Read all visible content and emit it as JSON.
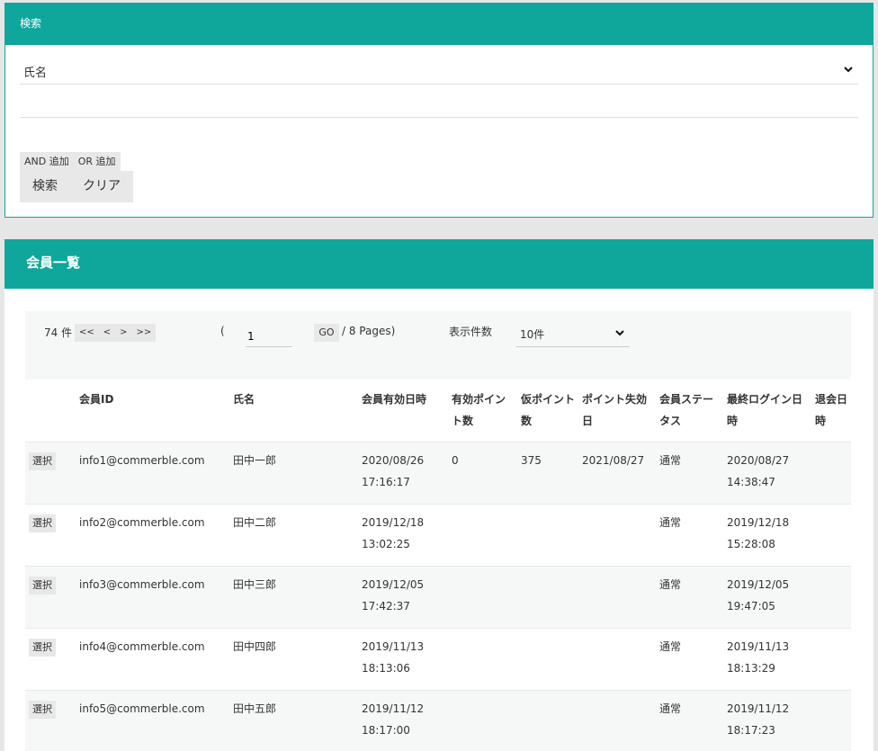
{
  "search": {
    "title": "検索",
    "field": "氏名",
    "input_value": "",
    "and_label": "AND 追加",
    "or_label": "OR 追加",
    "search_label": "検索",
    "clear_label": "クリア"
  },
  "list": {
    "title": "会員一覧",
    "pager": {
      "count": "74 件",
      "first": "<<",
      "prev": "<",
      "next": ">",
      "last": ">>",
      "paren": "(",
      "page": "1",
      "go": "GO",
      "pages": "/ 8 Pages)",
      "page_size_label": "表示件数",
      "page_size": "10件"
    },
    "columns": [
      "会員ID",
      "氏名",
      "会員有効日時",
      "有効ポイント数",
      "仮ポイント数",
      "ポイント失効日",
      "会員ステータス",
      "最終ログイン日時",
      "退会日時"
    ],
    "select_label": "選択",
    "rows": [
      [
        "info1@commerble.com",
        "田中一郎",
        "2020/08/26 17:16:17",
        "0",
        "375",
        "2021/08/27",
        "通常",
        "2020/08/27 14:38:47",
        ""
      ],
      [
        "info2@commerble.com",
        "田中二郎",
        "2019/12/18 13:02:25",
        "",
        "",
        "",
        "通常",
        "2019/12/18 15:28:08",
        ""
      ],
      [
        "info3@commerble.com",
        "田中三郎",
        "2019/12/05 17:42:37",
        "",
        "",
        "",
        "通常",
        "2019/12/05 19:47:05",
        ""
      ],
      [
        "info4@commerble.com",
        "田中四郎",
        "2019/11/13 18:13:06",
        "",
        "",
        "",
        "通常",
        "2019/11/13 18:13:29",
        ""
      ],
      [
        "info5@commerble.com",
        "田中五郎",
        "2019/11/12 18:17:00",
        "",
        "",
        "",
        "通常",
        "2019/11/12 18:17:23",
        ""
      ]
    ]
  },
  "icons": {
    "chevron": "chevron-down-icon"
  },
  "colors": {
    "accent": "#0fa69c",
    "background": "#e6e6e6",
    "button": "#e8e8e8"
  }
}
